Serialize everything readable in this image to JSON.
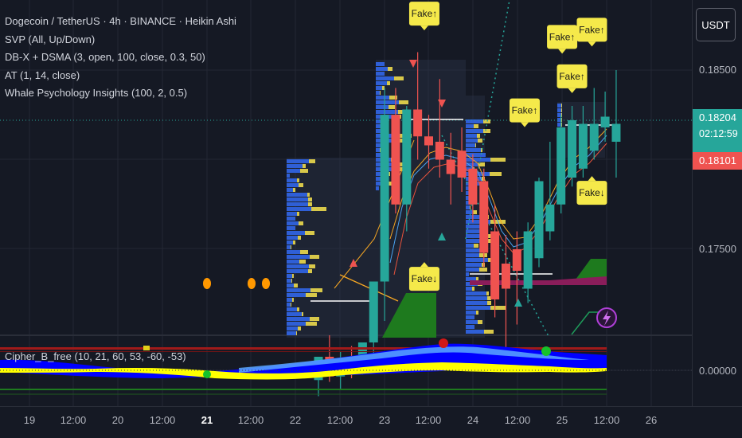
{
  "legend": {
    "symbol_line": "Dogecoin / TetherUS · 4h · BINANCE · Heikin Ashi",
    "indicator_1": "SVP (All, Up/Down)",
    "indicator_2": "DB-X + DSMA (3, open, 100, close, 0.3, 50)",
    "indicator_3": "AT (1, 14, close)",
    "indicator_4": "Whale Psychology Insights (100, 2, 0.5)"
  },
  "oscillator_label": "Cipher_B_free (10, 21, 60, 53, -60, -53)",
  "currency_button": "USDT",
  "price_tags": {
    "current_price": "0.18204",
    "countdown": "02:12:59",
    "second_price": "0.18101"
  },
  "colors": {
    "background": "#151924",
    "up": "#26a69a",
    "down": "#ef5350",
    "fake_label": "#f5e94a",
    "volume_profile_blue": "#2f5fd6",
    "volume_profile_yellow": "#d8c84a",
    "osc_blue": "#0000ff",
    "osc_yellow": "#ffff00",
    "orange_dot": "#ff9800"
  },
  "chart_data": {
    "type": "candlestick",
    "symbol": "Dogecoin / TetherUS",
    "interval": "4h",
    "exchange": "BINANCE",
    "style": "Heikin Ashi",
    "y_axis_ticks": [
      "0.18500",
      "0.17500",
      "0.00000"
    ],
    "ylim": [
      0.1678,
      0.1895
    ],
    "x_axis_ticks": [
      "19",
      "12:00",
      "20",
      "12:00",
      "21",
      "12:00",
      "22",
      "12:00",
      "23",
      "12:00",
      "24",
      "12:00",
      "25",
      "12:00",
      "26"
    ],
    "x_axis_bold": "21",
    "candles": [
      {
        "o": 0.1677,
        "h": 0.169,
        "l": 0.1668,
        "c": 0.169
      },
      {
        "o": 0.169,
        "h": 0.1702,
        "l": 0.1676,
        "c": 0.1679
      },
      {
        "o": 0.1679,
        "h": 0.1693,
        "l": 0.1672,
        "c": 0.1689
      },
      {
        "o": 0.1689,
        "h": 0.1696,
        "l": 0.1678,
        "c": 0.1683
      },
      {
        "o": 0.1683,
        "h": 0.1698,
        "l": 0.168,
        "c": 0.1698
      },
      {
        "o": 0.1698,
        "h": 0.173,
        "l": 0.169,
        "c": 0.1732
      },
      {
        "o": 0.1732,
        "h": 0.184,
        "l": 0.171,
        "c": 0.1825
      },
      {
        "o": 0.1825,
        "h": 0.184,
        "l": 0.177,
        "c": 0.1775
      },
      {
        "o": 0.1775,
        "h": 0.183,
        "l": 0.176,
        "c": 0.1828
      },
      {
        "o": 0.1828,
        "h": 0.186,
        "l": 0.18,
        "c": 0.1813
      },
      {
        "o": 0.1813,
        "h": 0.1825,
        "l": 0.1795,
        "c": 0.1808
      },
      {
        "o": 0.181,
        "h": 0.1845,
        "l": 0.179,
        "c": 0.18
      },
      {
        "o": 0.18,
        "h": 0.1815,
        "l": 0.1775,
        "c": 0.1792
      },
      {
        "o": 0.1805,
        "h": 0.1818,
        "l": 0.1782,
        "c": 0.179
      },
      {
        "o": 0.1795,
        "h": 0.1803,
        "l": 0.1765,
        "c": 0.1775
      },
      {
        "o": 0.1788,
        "h": 0.1795,
        "l": 0.174,
        "c": 0.1748
      },
      {
        "o": 0.176,
        "h": 0.1775,
        "l": 0.1712,
        "c": 0.1722
      },
      {
        "o": 0.1742,
        "h": 0.1758,
        "l": 0.169,
        "c": 0.1728
      },
      {
        "o": 0.175,
        "h": 0.176,
        "l": 0.1708,
        "c": 0.1738
      },
      {
        "o": 0.1728,
        "h": 0.1765,
        "l": 0.172,
        "c": 0.176
      },
      {
        "o": 0.1745,
        "h": 0.179,
        "l": 0.174,
        "c": 0.1788
      },
      {
        "o": 0.176,
        "h": 0.181,
        "l": 0.1755,
        "c": 0.1775
      },
      {
        "o": 0.1775,
        "h": 0.1825,
        "l": 0.177,
        "c": 0.1818
      },
      {
        "o": 0.179,
        "h": 0.183,
        "l": 0.1785,
        "c": 0.1822
      },
      {
        "o": 0.1795,
        "h": 0.183,
        "l": 0.179,
        "c": 0.182
      },
      {
        "o": 0.1805,
        "h": 0.184,
        "l": 0.18,
        "c": 0.182
      },
      {
        "o": 0.1818,
        "h": 0.1838,
        "l": 0.181,
        "c": 0.1824
      },
      {
        "o": 0.181,
        "h": 0.185,
        "l": 0.179,
        "c": 0.182
      }
    ],
    "fake_labels": [
      {
        "text": "Fake↑",
        "idx": 9.6,
        "price": 0.18815,
        "dir": "up"
      },
      {
        "text": "Fake↑",
        "idx": 22.1,
        "price": 0.18685,
        "dir": "up"
      },
      {
        "text": "Fake↑",
        "idx": 24.8,
        "price": 0.18725,
        "dir": "up"
      },
      {
        "text": "Fake↑",
        "idx": 23.0,
        "price": 0.18465,
        "dir": "up"
      },
      {
        "text": "Fake↑",
        "idx": 18.7,
        "price": 0.18275,
        "dir": "up"
      },
      {
        "text": "Fake↓",
        "idx": 9.6,
        "price": 0.17335,
        "dir": "down"
      },
      {
        "text": "Fake↓",
        "idx": 24.8,
        "price": 0.17815,
        "dir": "down"
      }
    ]
  }
}
